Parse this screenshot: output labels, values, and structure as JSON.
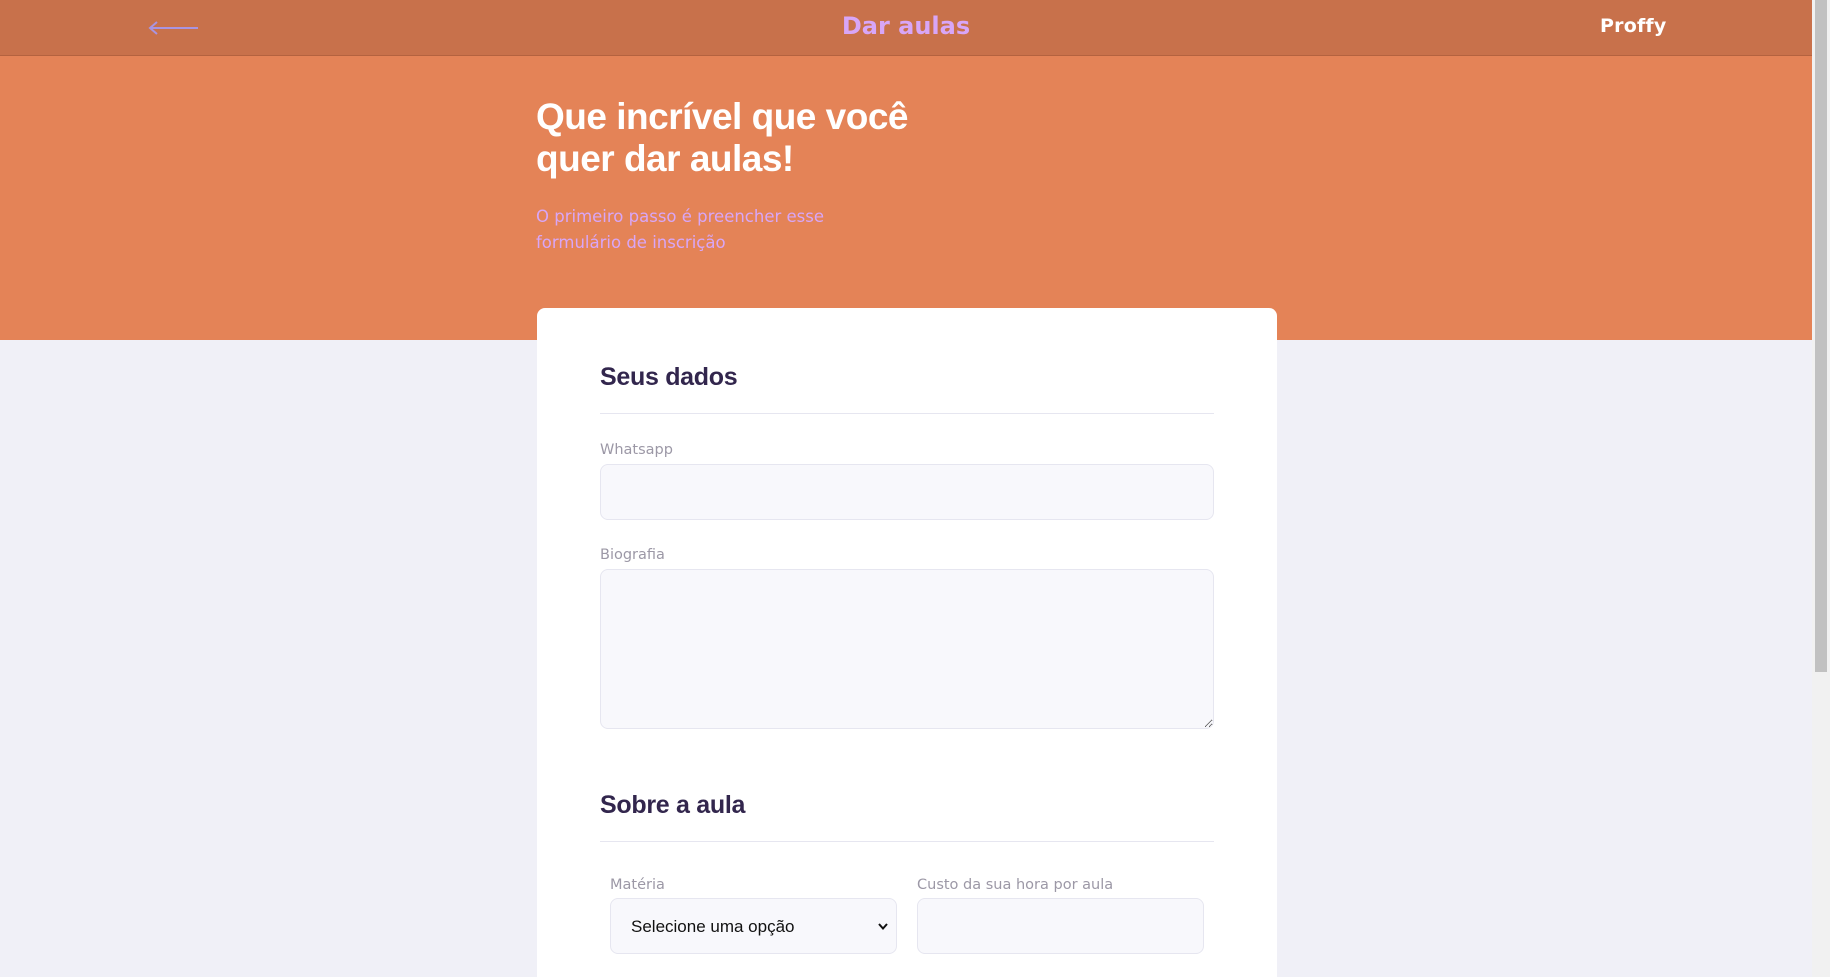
{
  "header": {
    "back_icon": "arrow-left-icon",
    "title": "Dar aulas",
    "logo": "Proffy"
  },
  "hero": {
    "heading_line1": "Que incrível que você",
    "heading_line2": "quer dar aulas!",
    "subtitle_line1": "O primeiro passo é preencher esse",
    "subtitle_line2": "formulário de inscrição"
  },
  "form": {
    "section_personal": "Seus dados",
    "whatsapp_label": "Whatsapp",
    "whatsapp_value": "",
    "bio_label": "Biografia",
    "bio_value": "",
    "section_class": "Sobre a aula",
    "subject_label": "Matéria",
    "subject_selected": "Selecione uma opção",
    "cost_label": "Custo da sua hora por aula",
    "cost_value": ""
  },
  "colors": {
    "topbar": "#C8714B",
    "hero": "#E48357",
    "accent_purple": "#D8A6F7",
    "heading_dark": "#32264D",
    "background": "#F0F0F7"
  }
}
